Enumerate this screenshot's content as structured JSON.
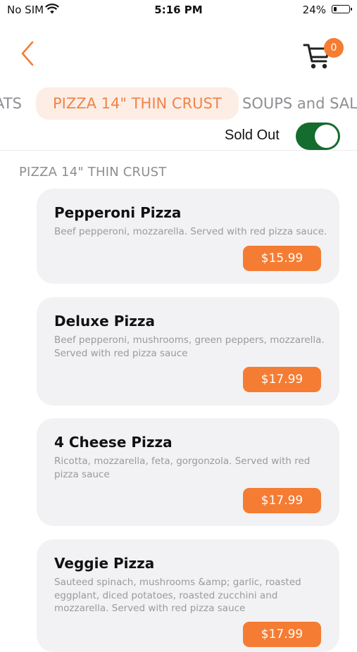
{
  "status_bar": {
    "carrier": "No SIM",
    "time": "5:16 PM",
    "battery_percent": "24%",
    "battery_level": 0.24
  },
  "header": {
    "back_icon": "chevron-left-icon",
    "cart_icon": "cart-icon",
    "cart_count": "0"
  },
  "tabs": [
    {
      "label": "ATS",
      "active": false
    },
    {
      "label": "PIZZA 14\" THIN CRUST",
      "active": true
    },
    {
      "label": "SOUPS and SALADS",
      "active": false
    }
  ],
  "sold_out": {
    "label": "Sold Out",
    "on": true
  },
  "section": {
    "title": "PIZZA 14\" THIN CRUST"
  },
  "items": [
    {
      "name": "Pepperoni Pizza",
      "description": "Beef pepperoni, mozzarella. Served with red pizza sauce.",
      "price": "$15.99"
    },
    {
      "name": "Deluxe Pizza",
      "description": "Beef pepperoni, mushrooms, green peppers, mozzarella. Served with red pizza sauce",
      "price": "$17.99"
    },
    {
      "name": "4 Cheese Pizza",
      "description": "Ricotta, mozzarella, feta, gorgonzola. Served with red pizza sauce",
      "price": "$17.99"
    },
    {
      "name": "Veggie Pizza",
      "description": "Sauteed spinach, mushrooms &amp; garlic, roasted eggplant, diced potatoes, roasted zucchini and mozzarella. Served with red pizza sauce",
      "price": "$17.99"
    }
  ],
  "colors": {
    "accent": "#F57C33",
    "toggle_on": "#146C2E",
    "active_tab_bg": "#FDEEE5"
  }
}
